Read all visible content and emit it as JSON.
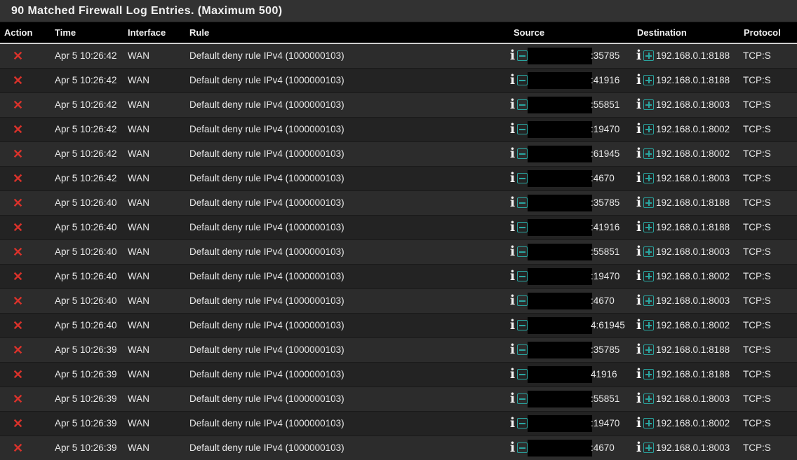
{
  "heading": "90 Matched Firewall Log Entries. (Maximum 500)",
  "columns": {
    "action": "Action",
    "time": "Time",
    "interface": "Interface",
    "rule": "Rule",
    "source": "Source",
    "destination": "Destination",
    "protocol": "Protocol"
  },
  "colors": {
    "block": "#d9322b",
    "accent": "#2aa5a0",
    "header_bg": "#000000"
  },
  "icons": {
    "action": "block-x-icon",
    "info": "info-icon",
    "source_btn": "minus-box-icon",
    "dest_btn": "plus-box-icon"
  },
  "rows": [
    {
      "time": "Apr 5 10:26:42",
      "interface": "WAN",
      "rule": "Default deny rule IPv4 (1000000103)",
      "src_port": ":35785",
      "dst": "192.168.0.1:8188",
      "proto": "TCP:S"
    },
    {
      "time": "Apr 5 10:26:42",
      "interface": "WAN",
      "rule": "Default deny rule IPv4 (1000000103)",
      "src_port": ":41916",
      "dst": "192.168.0.1:8188",
      "proto": "TCP:S"
    },
    {
      "time": "Apr 5 10:26:42",
      "interface": "WAN",
      "rule": "Default deny rule IPv4 (1000000103)",
      "src_port": ":55851",
      "dst": "192.168.0.1:8003",
      "proto": "TCP:S"
    },
    {
      "time": "Apr 5 10:26:42",
      "interface": "WAN",
      "rule": "Default deny rule IPv4 (1000000103)",
      "src_port": ":19470",
      "dst": "192.168.0.1:8002",
      "proto": "TCP:S"
    },
    {
      "time": "Apr 5 10:26:42",
      "interface": "WAN",
      "rule": "Default deny rule IPv4 (1000000103)",
      "src_port": ":61945",
      "dst": "192.168.0.1:8002",
      "proto": "TCP:S"
    },
    {
      "time": "Apr 5 10:26:42",
      "interface": "WAN",
      "rule": "Default deny rule IPv4 (1000000103)",
      "src_port": ":4670",
      "dst": "192.168.0.1:8003",
      "proto": "TCP:S"
    },
    {
      "time": "Apr 5 10:26:40",
      "interface": "WAN",
      "rule": "Default deny rule IPv4 (1000000103)",
      "src_port": ":35785",
      "dst": "192.168.0.1:8188",
      "proto": "TCP:S"
    },
    {
      "time": "Apr 5 10:26:40",
      "interface": "WAN",
      "rule": "Default deny rule IPv4 (1000000103)",
      "src_port": ":41916",
      "dst": "192.168.0.1:8188",
      "proto": "TCP:S"
    },
    {
      "time": "Apr 5 10:26:40",
      "interface": "WAN",
      "rule": "Default deny rule IPv4 (1000000103)",
      "src_port": ":55851",
      "dst": "192.168.0.1:8003",
      "proto": "TCP:S"
    },
    {
      "time": "Apr 5 10:26:40",
      "interface": "WAN",
      "rule": "Default deny rule IPv4 (1000000103)",
      "src_port": ":19470",
      "dst": "192.168.0.1:8002",
      "proto": "TCP:S"
    },
    {
      "time": "Apr 5 10:26:40",
      "interface": "WAN",
      "rule": "Default deny rule IPv4 (1000000103)",
      "src_port": ":4670",
      "dst": "192.168.0.1:8003",
      "proto": "TCP:S"
    },
    {
      "time": "Apr 5 10:26:40",
      "interface": "WAN",
      "rule": "Default deny rule IPv4 (1000000103)",
      "src_port": "4:61945",
      "dst": "192.168.0.1:8002",
      "proto": "TCP:S"
    },
    {
      "time": "Apr 5 10:26:39",
      "interface": "WAN",
      "rule": "Default deny rule IPv4 (1000000103)",
      "src_port": ":35785",
      "dst": "192.168.0.1:8188",
      "proto": "TCP:S"
    },
    {
      "time": "Apr 5 10:26:39",
      "interface": "WAN",
      "rule": "Default deny rule IPv4 (1000000103)",
      "src_port": "41916",
      "dst": "192.168.0.1:8188",
      "proto": "TCP:S"
    },
    {
      "time": "Apr 5 10:26:39",
      "interface": "WAN",
      "rule": "Default deny rule IPv4 (1000000103)",
      "src_port": ":55851",
      "dst": "192.168.0.1:8003",
      "proto": "TCP:S"
    },
    {
      "time": "Apr 5 10:26:39",
      "interface": "WAN",
      "rule": "Default deny rule IPv4 (1000000103)",
      "src_port": ":19470",
      "dst": "192.168.0.1:8002",
      "proto": "TCP:S"
    },
    {
      "time": "Apr 5 10:26:39",
      "interface": "WAN",
      "rule": "Default deny rule IPv4 (1000000103)",
      "src_port": ":4670",
      "dst": "192.168.0.1:8003",
      "proto": "TCP:S"
    }
  ]
}
